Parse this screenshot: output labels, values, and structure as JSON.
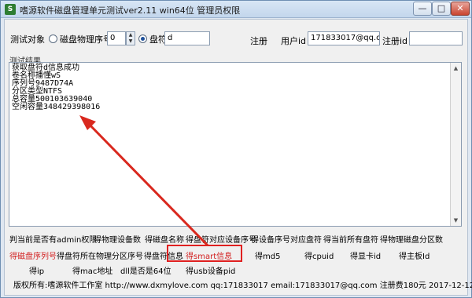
{
  "window": {
    "title": "嗜源软件磁盘管理单元测试ver2.11 win64位 管理员权限",
    "app_icon_glyph": "S",
    "minimize": "—",
    "maximize": "□",
    "close": "✕"
  },
  "top": {
    "test_object_label": "测试对象",
    "radio_physical_label": "磁盘物理序号",
    "physical_value": "0",
    "radio_drive_label": "盘符",
    "drive_value": "d",
    "register_label": "注册",
    "user_id_label": "用户id",
    "user_id_value": "171833017@qq.com",
    "register_id_label": "注册id",
    "register_id_value": ""
  },
  "result": {
    "label": "测试结果",
    "lines": [
      "获取盘符d信息成功",
      "卷名称播懂wS",
      "序列号9487D74A",
      "分区类型NTFS",
      "总容量500103639040",
      "空闲容量348429398016"
    ]
  },
  "commands": {
    "row1": [
      "判当前是否有admin权限",
      "得物理设备数",
      "得磁盘名称",
      "得盘符对应设备序号",
      "得设备序号对应盘符",
      "得当前所有盘符",
      "得物理磁盘分区数"
    ],
    "row2": [
      "得磁盘序列号",
      "得盘符所在物理分区序号",
      "得盘符信息",
      "得smart信息",
      "得md5",
      "得cpuid",
      "得显卡id",
      "得主板Id"
    ],
    "row3": [
      "得ip",
      "得mac地址",
      "dll是否是64位",
      "得usb设备pid"
    ]
  },
  "footer": {
    "text": "版权所有:嗜源软件工作室 http://www.dxmylove.com qq:171833017 email:171833017@qq.com 注册费180元 2017-12-12"
  },
  "colors": {
    "accent_red": "#d21f1f",
    "highlight": "#e02020"
  }
}
